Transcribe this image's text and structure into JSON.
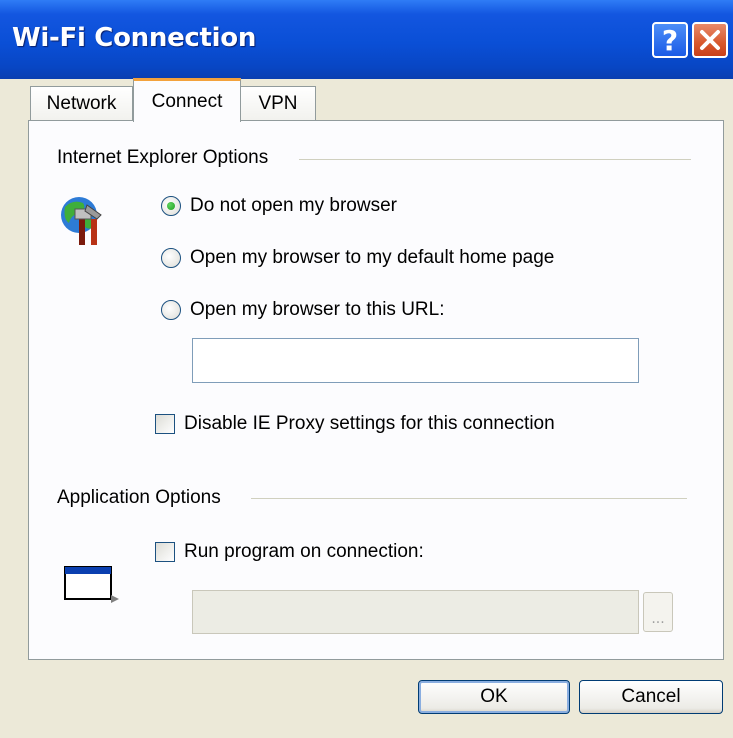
{
  "window": {
    "title": "Wi-Fi Connection",
    "help_icon": "help-icon",
    "close_icon": "close-icon",
    "help_label": "?"
  },
  "tabs": [
    {
      "label": "Network",
      "selected": false
    },
    {
      "label": "Connect",
      "selected": true
    },
    {
      "label": "VPN",
      "selected": false
    }
  ],
  "ie_options": {
    "group_label": "Internet Explorer Options",
    "icon": "ie-options-icon",
    "radios": [
      {
        "label": "Do not open my browser",
        "checked": true
      },
      {
        "label": "Open my browser to my default home page",
        "checked": false
      },
      {
        "label": "Open my browser to this URL:",
        "checked": false
      }
    ],
    "url_value": "",
    "proxy_checkbox": {
      "label": "Disable IE Proxy settings for this connection",
      "checked": false
    }
  },
  "app_options": {
    "group_label": "Application Options",
    "icon": "program-window-icon",
    "run_checkbox": {
      "label": "Run program on connection:",
      "checked": false
    },
    "program_value": "",
    "browse_label": "..."
  },
  "buttons": {
    "ok": "OK",
    "cancel": "Cancel"
  },
  "colors": {
    "titlebar": "#0a4fd6",
    "dialog_bg": "#ece9d8",
    "tab_accent": "#f3a23c"
  }
}
